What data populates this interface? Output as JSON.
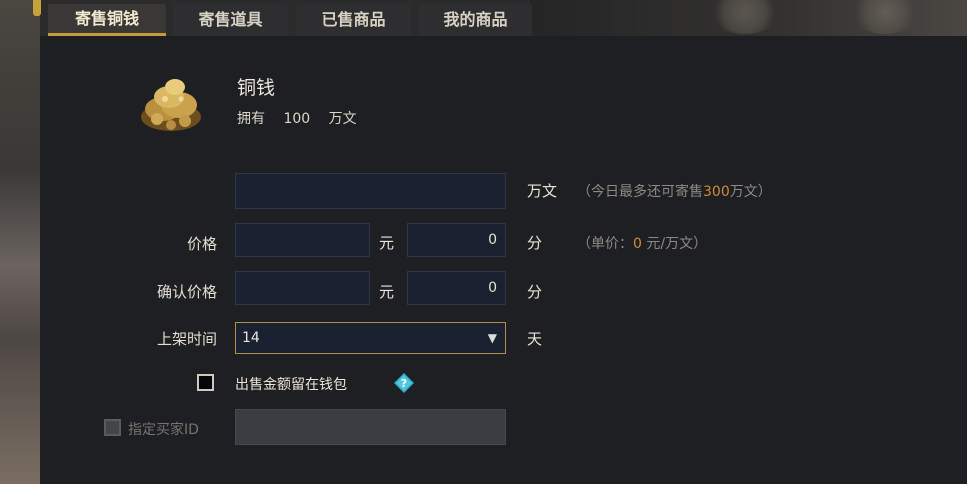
{
  "tabs": [
    {
      "label": "寄售铜钱",
      "active": true
    },
    {
      "label": "寄售道具",
      "active": false
    },
    {
      "label": "已售商品",
      "active": false
    },
    {
      "label": "我的商品",
      "active": false
    }
  ],
  "item": {
    "name": "铜钱",
    "own_label": "拥有",
    "own_value": "100",
    "own_unit": "万文",
    "icon": "copper-coins-icon"
  },
  "form": {
    "amount": {
      "value": "",
      "unit": "万文",
      "hint_prefix": "（今日最多还可寄售",
      "hint_value": "300",
      "hint_suffix": "万文）"
    },
    "price": {
      "label": "价格",
      "yuan_value": "",
      "yuan_unit": "元",
      "fen_value": "0",
      "fen_unit": "分",
      "unit_hint_prefix": "（单价：",
      "unit_hint_value": "0",
      "unit_hint_suffix": " 元/万文）"
    },
    "confirm_price": {
      "label": "确认价格",
      "yuan_value": "",
      "yuan_unit": "元",
      "fen_value": "0",
      "fen_unit": "分"
    },
    "duration": {
      "label": "上架时间",
      "selected": "14",
      "unit": "天"
    },
    "keep_in_wallet": {
      "label": "出售金额留在钱包",
      "checked": false,
      "help_icon": "help-diamond-icon"
    },
    "designate_buyer": {
      "label": "指定买家ID",
      "enabled": false,
      "value": ""
    }
  },
  "colors": {
    "accent_gold": "#c99a3c",
    "highlight_orange": "#d38a38",
    "panel_bg": "#1d1f23",
    "field_bg": "#1a2130"
  }
}
